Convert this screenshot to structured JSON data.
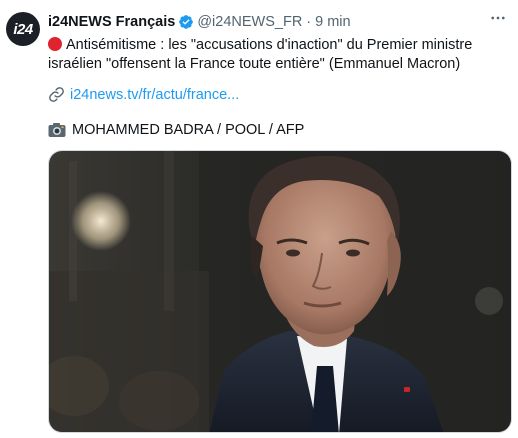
{
  "tweet": {
    "author_name": "i24NEWS Français",
    "handle": "@i24NEWS_FR",
    "separator": "·",
    "time": "9 min",
    "avatar_text": "i24",
    "text": "Antisémitisme : les \"accusations d'inaction\" du Premier ministre israélien \"offensent la France toute entière\" (Emmanuel Macron)",
    "link": "i24news.tv/fr/actu/france...",
    "photo_credit": "MOHAMMED BADRA / POOL / AFP"
  },
  "icons": {
    "verified": "verified-badge-icon",
    "more": "more-options-icon",
    "alert": "red-circle-icon",
    "link": "link-icon",
    "camera": "camera-icon"
  },
  "colors": {
    "accent": "#1d9bf0",
    "text": "#0f1419",
    "secondary": "#536471",
    "alert_red": "#e0242f"
  }
}
